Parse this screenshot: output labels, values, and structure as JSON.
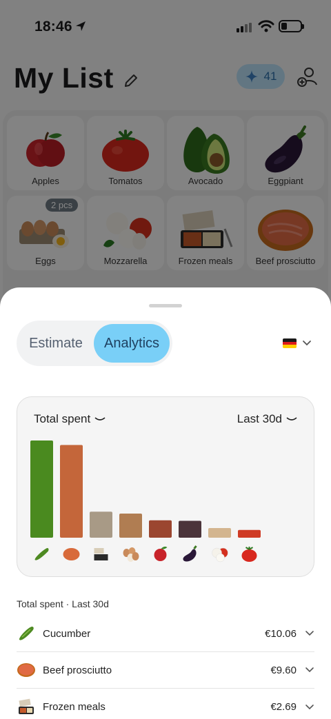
{
  "status_bar": {
    "time": "18:46"
  },
  "header": {
    "title": "My List",
    "credits_count": "41"
  },
  "grid": [
    {
      "label": "Apples",
      "icon": "apple-icon"
    },
    {
      "label": "Tomatos",
      "icon": "tomato-icon"
    },
    {
      "label": "Avocado",
      "icon": "avocado-icon"
    },
    {
      "label": "Eggpiant",
      "icon": "eggplant-icon"
    },
    {
      "label": "Eggs",
      "icon": "eggs-icon",
      "badge": "2 pcs"
    },
    {
      "label": "Mozzarella",
      "icon": "mozzarella-icon"
    },
    {
      "label": "Frozen meals",
      "icon": "frozen-meal-icon"
    },
    {
      "label": "Beef prosciutto",
      "icon": "prosciutto-icon"
    }
  ],
  "sheet": {
    "tabs": [
      "Estimate",
      "Analytics"
    ],
    "active_tab": "Analytics",
    "currency_flag": "germany-flag-icon",
    "chart": {
      "metric_label": "Total spent",
      "range_label": "Last 30d"
    },
    "summary_label": "Total spent · Last 30d",
    "rows": [
      {
        "name": "Cucumber",
        "amount": "€10.06",
        "icon": "cucumber-icon"
      },
      {
        "name": "Beef prosciutto",
        "amount": "€9.60",
        "icon": "prosciutto-icon"
      },
      {
        "name": "Frozen meals",
        "amount": "€2.69",
        "icon": "frozen-meal-icon"
      }
    ]
  },
  "chart_data": {
    "type": "bar",
    "categories": [
      "Cucumber",
      "Beef prosciutto",
      "Frozen meals",
      "Eggs",
      "Apples",
      "Eggplant",
      "Mozzarella",
      "Tomatos"
    ],
    "values": [
      10.06,
      9.6,
      2.69,
      2.5,
      1.8,
      1.75,
      1.0,
      0.8
    ],
    "colors": [
      "#4a8a1f",
      "#c4663a",
      "#a89a86",
      "#b07d52",
      "#9b4630",
      "#4b343a",
      "#d3b58f",
      "#cf3b25"
    ],
    "title": "Total spent",
    "xlabel": "",
    "ylabel": "",
    "ylim": [
      0,
      10.06
    ],
    "grid": false
  }
}
